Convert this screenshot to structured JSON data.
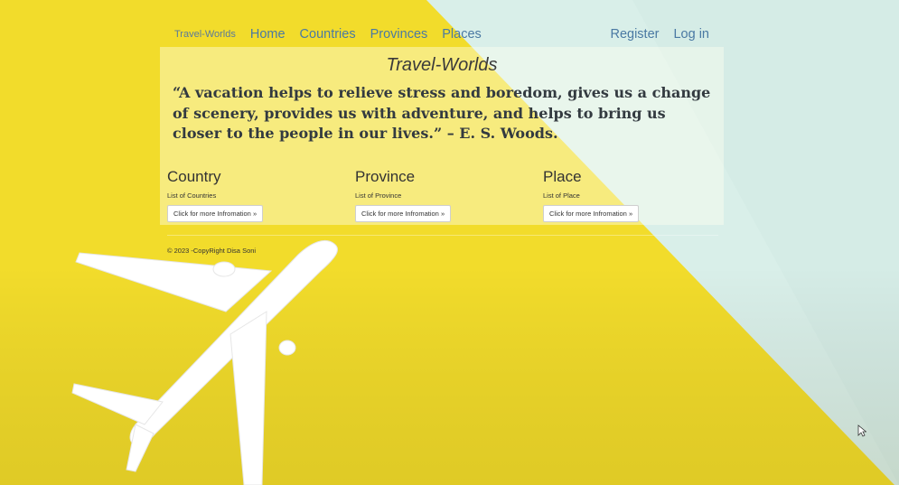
{
  "navbar": {
    "brand": "Travel-Worlds",
    "links": [
      "Home",
      "Countries",
      "Provinces",
      "Places"
    ],
    "right_links": [
      "Register",
      "Log in"
    ]
  },
  "jumbotron": {
    "title": "Travel-Worlds",
    "quote": "“A vacation helps to relieve stress and boredom, gives us a change of scenery, provides us with adventure, and helps to bring us closer to the people in our lives.” – E. S. Woods."
  },
  "sections": [
    {
      "title": "Country",
      "subtitle": "List of Countries",
      "button": "Click for more Infromation »"
    },
    {
      "title": "Province",
      "subtitle": "List of Province",
      "button": "Click for more Infromation »"
    },
    {
      "title": "Place",
      "subtitle": "List of Place",
      "button": "Click for more Infromation »"
    }
  ],
  "footer": {
    "text": "© 2023 -CopyRight Disa Soni"
  },
  "colors": {
    "yellow": "#f2dc2b",
    "mint": "#d9efe9",
    "link": "#4a79a3"
  }
}
